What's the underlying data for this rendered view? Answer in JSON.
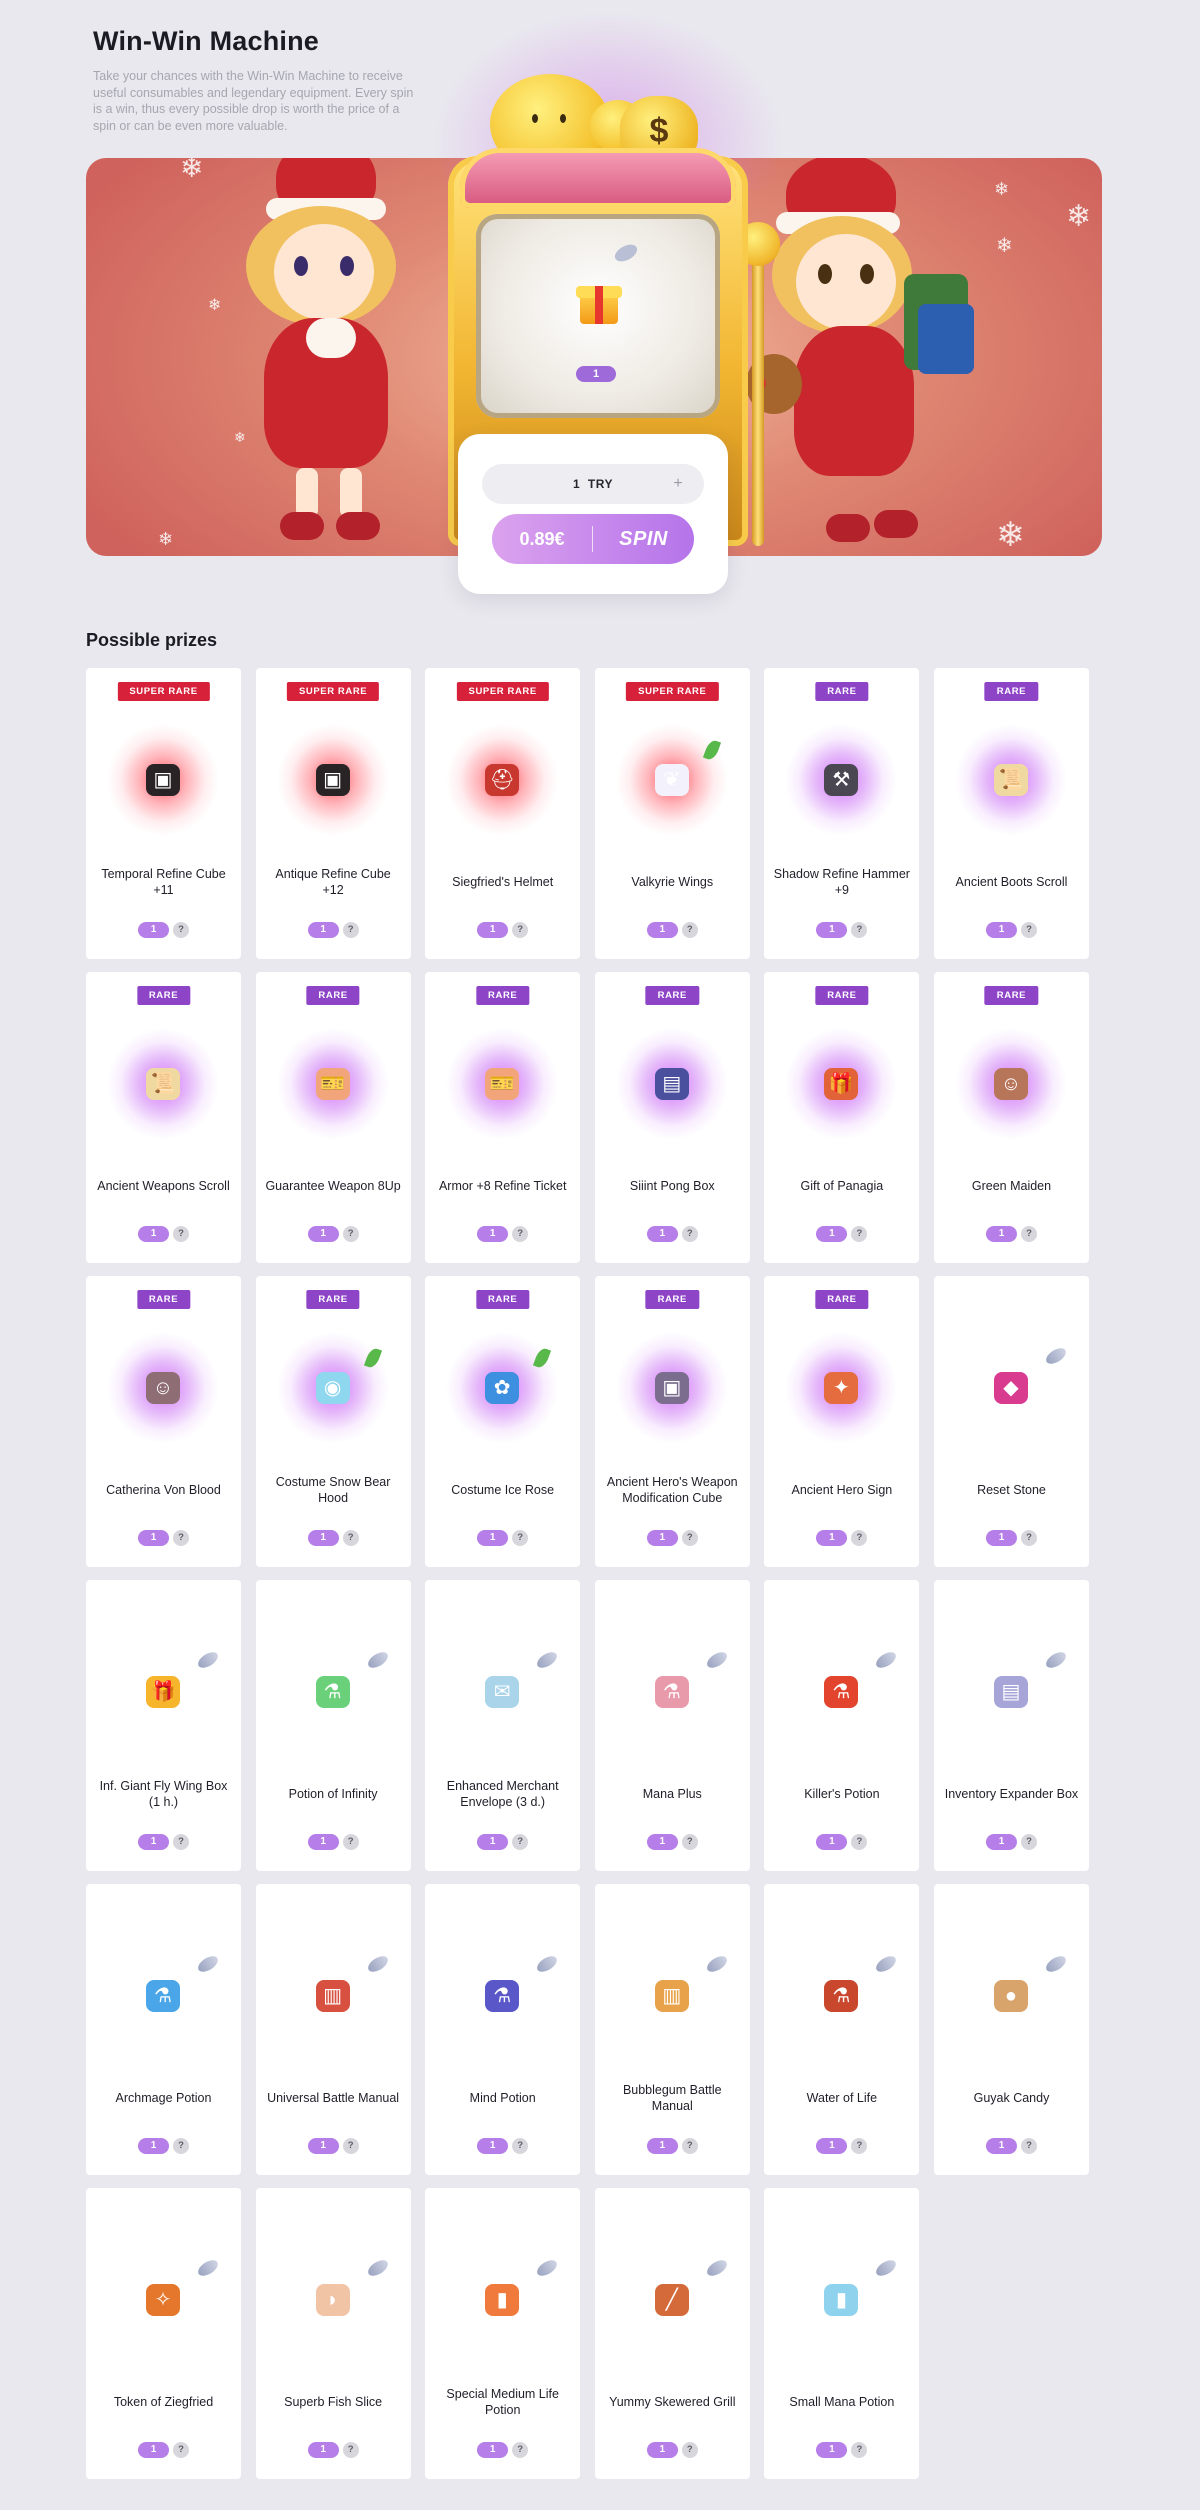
{
  "header": {
    "title": "Win-Win Machine",
    "description": "Take your chances with the Win-Win Machine to receive useful consumables and legendary equipment. Every spin is a win, thus every possible drop is worth the price of a spin or can be even more valuable."
  },
  "machine": {
    "current_item_icon": "gift-box-icon",
    "current_item_count": "1"
  },
  "spin_panel": {
    "quantity": "1",
    "try_label": "TRY",
    "plus_label": "+",
    "price": "0.89€",
    "spin_label": "SPIN"
  },
  "prizes": {
    "title": "Possible prizes",
    "items": [
      {
        "name": "Temporal Refine Cube +11",
        "rarity": "SUPER RARE",
        "qty": "1",
        "icon": "cube-icon",
        "color": "#2a2326"
      },
      {
        "name": "Antique Refine Cube +12",
        "rarity": "SUPER RARE",
        "qty": "1",
        "icon": "cube-icon",
        "color": "#2a2326"
      },
      {
        "name": "Siegfried's Helmet",
        "rarity": "SUPER RARE",
        "qty": "1",
        "icon": "helmet-icon",
        "color": "#c8382e"
      },
      {
        "name": "Valkyrie Wings",
        "rarity": "SUPER RARE",
        "qty": "1",
        "icon": "wings-icon",
        "color": "#f3f1fb"
      },
      {
        "name": "Shadow Refine Hammer +9",
        "rarity": "RARE",
        "qty": "1",
        "icon": "hammer-icon",
        "color": "#4a4652"
      },
      {
        "name": "Ancient Boots Scroll",
        "rarity": "RARE",
        "qty": "1",
        "icon": "scroll-icon",
        "color": "#f0d9a0"
      },
      {
        "name": "Ancient Weapons Scroll",
        "rarity": "RARE",
        "qty": "1",
        "icon": "scroll-icon",
        "color": "#f0d9a0"
      },
      {
        "name": "Guarantee Weapon 8Up",
        "rarity": "RARE",
        "qty": "1",
        "icon": "ticket-icon",
        "color": "#f2a57a"
      },
      {
        "name": "Armor +8 Refine Ticket",
        "rarity": "RARE",
        "qty": "1",
        "icon": "ticket-icon",
        "color": "#f2a57a"
      },
      {
        "name": "Siiint Pong Box",
        "rarity": "RARE",
        "qty": "1",
        "icon": "box-icon",
        "color": "#4a4f9e"
      },
      {
        "name": "Gift of Panagia",
        "rarity": "RARE",
        "qty": "1",
        "icon": "gift-icon",
        "color": "#e2623a"
      },
      {
        "name": "Green Maiden",
        "rarity": "RARE",
        "qty": "1",
        "icon": "doll-icon",
        "color": "#b7765a"
      },
      {
        "name": "Catherina Von Blood",
        "rarity": "RARE",
        "qty": "1",
        "icon": "doll-icon",
        "color": "#8e6e74"
      },
      {
        "name": "Costume Snow Bear Hood",
        "rarity": "RARE",
        "qty": "1",
        "icon": "hood-icon",
        "color": "#8fd6ef"
      },
      {
        "name": "Costume Ice Rose",
        "rarity": "RARE",
        "qty": "1",
        "icon": "rose-icon",
        "color": "#3d8fe0"
      },
      {
        "name": "Ancient Hero's Weapon Modification Cube",
        "rarity": "RARE",
        "qty": "1",
        "icon": "cube-icon",
        "color": "#7a6d8e"
      },
      {
        "name": "Ancient Hero Sign",
        "rarity": "RARE",
        "qty": "1",
        "icon": "sign-icon",
        "color": "#e46c3e"
      },
      {
        "name": "Reset Stone",
        "rarity": "",
        "qty": "1",
        "icon": "stone-icon",
        "color": "#d93c8f"
      },
      {
        "name": "Inf. Giant Fly Wing Box (1 h.)",
        "rarity": "",
        "qty": "1",
        "icon": "gift-box-icon",
        "color": "#f7b52b"
      },
      {
        "name": "Potion of Infinity",
        "rarity": "",
        "qty": "1",
        "icon": "potion-icon",
        "color": "#6bd07a"
      },
      {
        "name": "Enhanced Merchant Envelope (3 d.)",
        "rarity": "",
        "qty": "1",
        "icon": "envelope-icon",
        "color": "#a9d4ea"
      },
      {
        "name": "Mana Plus",
        "rarity": "",
        "qty": "1",
        "icon": "potion-icon",
        "color": "#e99aaa"
      },
      {
        "name": "Killer's Potion",
        "rarity": "",
        "qty": "1",
        "icon": "potion-icon",
        "color": "#e2442d"
      },
      {
        "name": "Inventory Expander Box",
        "rarity": "",
        "qty": "1",
        "icon": "box-icon",
        "color": "#a7a4d8"
      },
      {
        "name": "Archmage Potion",
        "rarity": "",
        "qty": "1",
        "icon": "potion-icon",
        "color": "#4aa6e8"
      },
      {
        "name": "Universal Battle Manual",
        "rarity": "",
        "qty": "1",
        "icon": "book-icon",
        "color": "#d8503f"
      },
      {
        "name": "Mind Potion",
        "rarity": "",
        "qty": "1",
        "icon": "potion-icon",
        "color": "#5a58c8"
      },
      {
        "name": "Bubblegum Battle Manual",
        "rarity": "",
        "qty": "1",
        "icon": "book-icon",
        "color": "#e8a24a"
      },
      {
        "name": "Water of Life",
        "rarity": "",
        "qty": "1",
        "icon": "potion-icon",
        "color": "#c8472d"
      },
      {
        "name": "Guyak Candy",
        "rarity": "",
        "qty": "1",
        "icon": "candy-icon",
        "color": "#d9a46c"
      },
      {
        "name": "Token of Ziegfried",
        "rarity": "",
        "qty": "1",
        "icon": "token-icon",
        "color": "#e5772d"
      },
      {
        "name": "Superb Fish Slice",
        "rarity": "",
        "qty": "1",
        "icon": "fish-icon",
        "color": "#f2c4a6"
      },
      {
        "name": "Special Medium Life Potion",
        "rarity": "",
        "qty": "1",
        "icon": "jar-icon",
        "color": "#f07a3c"
      },
      {
        "name": "Yummy Skewered Grill",
        "rarity": "",
        "qty": "1",
        "icon": "skewer-icon",
        "color": "#d46a3a"
      },
      {
        "name": "Small Mana Potion",
        "rarity": "",
        "qty": "1",
        "icon": "jar-icon",
        "color": "#8fd2ee"
      }
    ]
  }
}
